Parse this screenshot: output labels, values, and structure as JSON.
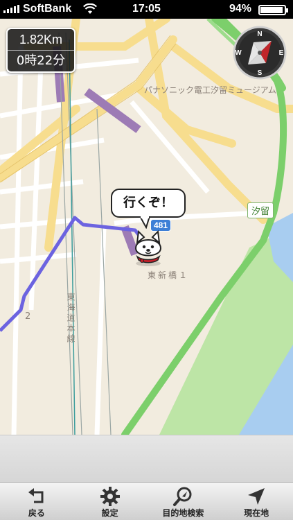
{
  "status_bar": {
    "carrier": "SoftBank",
    "time": "17:05",
    "battery_text": "94%",
    "battery_level": 0.94,
    "signal_bars": 5
  },
  "route_info": {
    "distance": "1.82Km",
    "duration": "0時22分"
  },
  "compass": {
    "n": "N",
    "e": "E",
    "s": "S",
    "w": "W"
  },
  "map": {
    "labels": {
      "museum": "パナソニック電工汐留ミュージアム",
      "shiodome": "汐留",
      "route_badge": "481",
      "higashi_shinbashi": "東新橋１",
      "tokaido_line": "東海道本線",
      "block_2": "2"
    },
    "colors": {
      "background": "#f2ecdf",
      "major_road": "#f7dd8e",
      "expressway": "#7ccf6b",
      "park": "#bde5a6",
      "water": "#a8cdf0",
      "rail": "#9d7bb5",
      "route_line": "#6c63e0"
    }
  },
  "character": {
    "speech": "行くぞ！"
  },
  "toolbar": {
    "items": [
      {
        "label": "戻る",
        "icon": "back-icon"
      },
      {
        "label": "設定",
        "icon": "gear-icon"
      },
      {
        "label": "目的地検索",
        "icon": "search-icon"
      },
      {
        "label": "現在地",
        "icon": "location-arrow-icon"
      }
    ]
  }
}
